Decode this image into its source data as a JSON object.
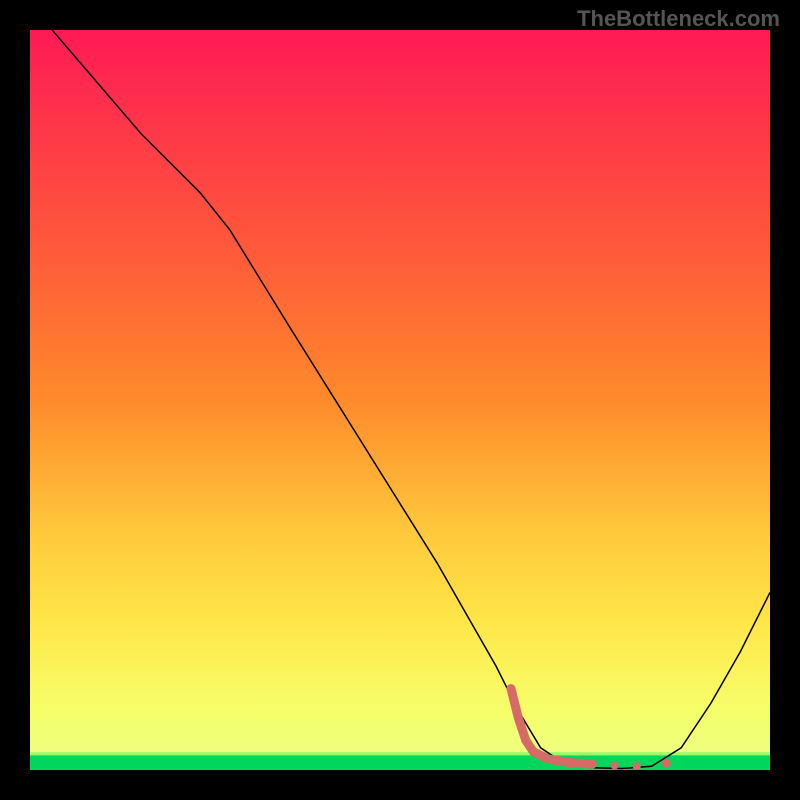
{
  "watermark": "TheBottleneck.com",
  "chart_data": {
    "type": "line",
    "title": "",
    "xlabel": "",
    "ylabel": "",
    "xlim": [
      0,
      100
    ],
    "ylim": [
      0,
      100
    ],
    "gradient_colors": {
      "top": "#ff1a55",
      "upper_mid": "#ff8a2b",
      "mid": "#ffe648",
      "lower_mid": "#f6ff6a",
      "bottom_band": "#00d65b"
    },
    "series": [
      {
        "name": "curve",
        "color": "#000000",
        "stroke_width": 1.5,
        "points": [
          {
            "x": 3,
            "y": 100
          },
          {
            "x": 15,
            "y": 86
          },
          {
            "x": 23,
            "y": 78
          },
          {
            "x": 27,
            "y": 73
          },
          {
            "x": 35,
            "y": 60
          },
          {
            "x": 45,
            "y": 44
          },
          {
            "x": 55,
            "y": 28
          },
          {
            "x": 63,
            "y": 14
          },
          {
            "x": 66,
            "y": 8
          },
          {
            "x": 69,
            "y": 3
          },
          {
            "x": 72,
            "y": 1
          },
          {
            "x": 76,
            "y": 0.3
          },
          {
            "x": 80,
            "y": 0.2
          },
          {
            "x": 84,
            "y": 0.5
          },
          {
            "x": 88,
            "y": 3
          },
          {
            "x": 92,
            "y": 9
          },
          {
            "x": 96,
            "y": 16
          },
          {
            "x": 100,
            "y": 24
          }
        ]
      },
      {
        "name": "marker-trail",
        "color": "#d66a66",
        "stroke_width": 9,
        "points": [
          {
            "x": 65,
            "y": 11
          },
          {
            "x": 66,
            "y": 7
          },
          {
            "x": 67,
            "y": 4
          },
          {
            "x": 68,
            "y": 2.5
          },
          {
            "x": 70,
            "y": 1.5
          },
          {
            "x": 73,
            "y": 1.0
          },
          {
            "x": 76,
            "y": 0.8
          }
        ]
      }
    ],
    "marker_dots": [
      {
        "x": 79,
        "y": 0.6,
        "r": 4,
        "color": "#d66a66"
      },
      {
        "x": 82,
        "y": 0.5,
        "r": 4,
        "color": "#d66a66"
      },
      {
        "x": 86,
        "y": 0.9,
        "r": 4.5,
        "color": "#d66a66"
      }
    ]
  }
}
